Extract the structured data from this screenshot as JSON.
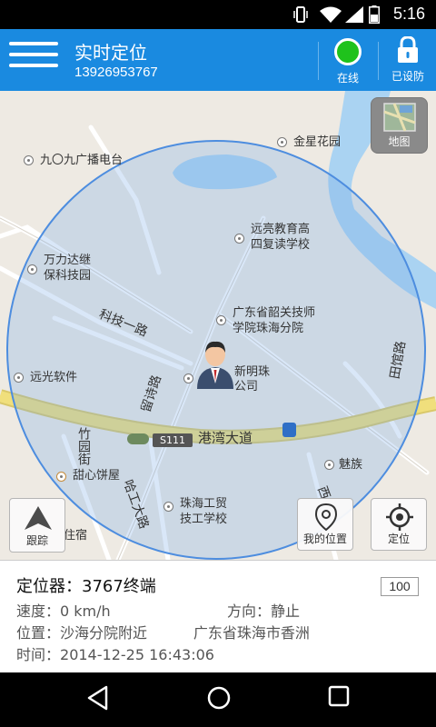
{
  "status_bar": {
    "time": "5:16"
  },
  "header": {
    "title": "实时定位",
    "subtitle": "13926953767",
    "online_label": "在线",
    "lock_label": "已设防",
    "accent": "#1a8ae0",
    "online_color": "#1fc21c"
  },
  "map": {
    "layer_button": "地图",
    "track_button": "跟踪",
    "my_location_button": "我的位置",
    "locate_button": "定位",
    "pois": [
      "九〇九广播电台",
      "金星花园",
      "万力达继\n保科技园",
      "远亮教育高\n四复读学校",
      "广东省韶关技师\n学院珠海分院",
      "远光软件",
      "新明珠",
      "公司",
      "魅族",
      "甜心饼屋",
      "珠海工贸\n技工学校",
      "住宿"
    ],
    "roads": [
      "科技一路",
      "留诗路",
      "港湾大道",
      "竹园街",
      "哈工大路",
      "田馆路",
      "西",
      "S111"
    ]
  },
  "info": {
    "device": "定位器：3767终端",
    "zoom": "100",
    "speed_label": "速度：",
    "speed_value": "0 km/h",
    "direction_label": "方向：",
    "direction_value": "静止",
    "address_label": "位置：",
    "address_value": "沙海分院附近          广东省珠海市香洲",
    "time_label": "时间：",
    "time_value": "2014-12-25 16:43:06"
  }
}
